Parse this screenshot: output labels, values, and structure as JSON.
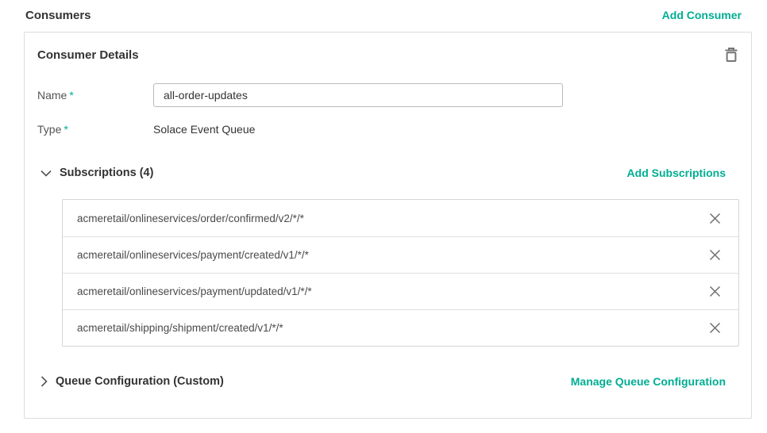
{
  "page": {
    "title": "Consumers",
    "add_consumer_label": "Add Consumer"
  },
  "card": {
    "title": "Consumer Details",
    "fields": {
      "name": {
        "label": "Name",
        "required_marker": "*",
        "value": "all-order-updates"
      },
      "type": {
        "label": "Type",
        "required_marker": "*",
        "value": "Solace Event Queue"
      }
    },
    "subscriptions": {
      "header": "Subscriptions (4)",
      "add_label": "Add Subscriptions",
      "items": [
        "acmeretail/onlineservices/order/confirmed/v2/*/*",
        "acmeretail/onlineservices/payment/created/v1/*/*",
        "acmeretail/onlineservices/payment/updated/v1/*/*",
        "acmeretail/shipping/shipment/created/v1/*/*"
      ]
    },
    "queue_config": {
      "header": "Queue Configuration (Custom)",
      "manage_label": "Manage Queue Configuration"
    }
  },
  "icons": {
    "trash": "trash-icon",
    "chevron_down": "chevron-down-icon",
    "chevron_right": "chevron-right-icon",
    "close": "x-icon"
  },
  "colors": {
    "accent": "#00ad93",
    "text_dark": "#333333",
    "text_label": "#545454",
    "icon_gray": "#757575",
    "border_card": "#dcdcdc",
    "border_input": "#b9b9b9",
    "border_list": "#d6d6d6"
  }
}
